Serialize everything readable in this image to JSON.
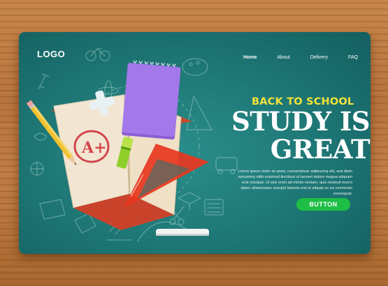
{
  "brand": {
    "logo": "LOGO"
  },
  "nav": {
    "items": [
      {
        "label": "Home",
        "active": true
      },
      {
        "label": "About",
        "active": false
      },
      {
        "label": "Delivery",
        "active": false
      },
      {
        "label": "FAQ",
        "active": false
      }
    ]
  },
  "hero": {
    "eyebrow": "BACK TO SCHOOL",
    "headline_line1": "STUDY IS",
    "headline_line2": "GREAT",
    "body": "Lorem ipsum dolor sit amet, consectetuer adipiscing elit, sed diam nonummy nibh euismod tincidunt ut laoreet dolore magna aliquam erat volutpat. Ut wisi enim ad minim veniam, quis nostrud exerci tation ullamcorper suscipit lobortis nisl ut aliquip ex ea commodo consequat.",
    "button_label": "BUTTON",
    "grade": "A+"
  },
  "colors": {
    "chalkboard": "#1f7a78",
    "accent_yellow": "#f3e33a",
    "button_green": "#1fbe45",
    "notebook_purple": "#9b6fe0",
    "ruler_red": "#e5381f",
    "wood": "#b9773f"
  }
}
